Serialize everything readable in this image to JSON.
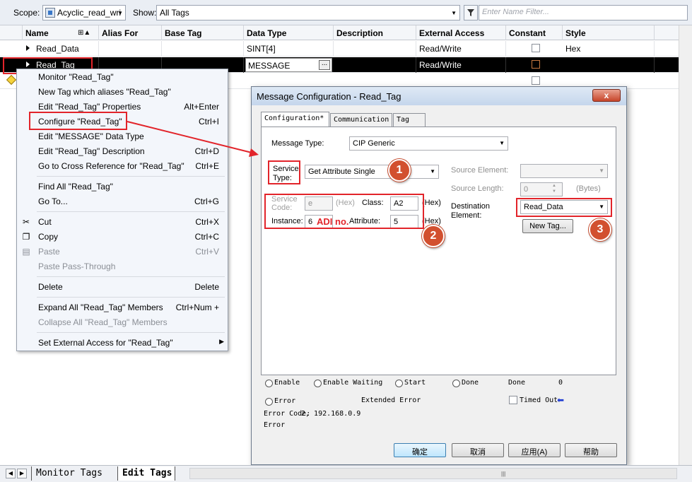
{
  "toolbar": {
    "scope_label": "Scope:",
    "scope_value": "Acyclic_read_wri",
    "show_label": "Show:",
    "show_value": "All Tags",
    "filter_placeholder": "Enter Name Filter..."
  },
  "grid": {
    "columns": [
      "Name",
      "Alias For",
      "Base Tag",
      "Data Type",
      "Description",
      "External Access",
      "Constant",
      "Style"
    ],
    "rows": [
      {
        "name": "Read_Data",
        "alias_for": "",
        "base_tag": "",
        "data_type": "SINT[4]",
        "description": "",
        "external_access": "Read/Write",
        "style": "Hex"
      },
      {
        "name": "Read_Tag",
        "alias_for": "",
        "base_tag": "",
        "data_type": "MESSAGE",
        "description": "",
        "external_access": "Read/Write",
        "style": ""
      }
    ],
    "ellipsis": "..."
  },
  "context_menu": {
    "items": [
      {
        "label": "Monitor \"Read_Tag\"",
        "shortcut": "",
        "disabled": false
      },
      {
        "label": "New Tag which aliases \"Read_Tag\"",
        "shortcut": "",
        "disabled": false
      },
      {
        "label": "Edit \"Read_Tag\" Properties",
        "shortcut": "Alt+Enter",
        "disabled": false
      },
      {
        "label": "Configure \"Read_Tag\"",
        "shortcut": "Ctrl+I",
        "disabled": false
      },
      {
        "label": "Edit \"MESSAGE\" Data Type",
        "shortcut": "",
        "disabled": false
      },
      {
        "label": "Edit \"Read_Tag\" Description",
        "shortcut": "Ctrl+D",
        "disabled": false
      },
      {
        "label": "Go to Cross Reference for \"Read_Tag\"",
        "shortcut": "Ctrl+E",
        "disabled": false
      },
      {
        "label": "Find All \"Read_Tag\"",
        "shortcut": "",
        "disabled": false
      },
      {
        "label": "Go To...",
        "shortcut": "Ctrl+G",
        "disabled": false
      },
      {
        "label": "Cut",
        "shortcut": "Ctrl+X",
        "disabled": false
      },
      {
        "label": "Copy",
        "shortcut": "Ctrl+C",
        "disabled": false
      },
      {
        "label": "Paste",
        "shortcut": "Ctrl+V",
        "disabled": true
      },
      {
        "label": "Paste Pass-Through",
        "shortcut": "",
        "disabled": true
      },
      {
        "label": "Delete",
        "shortcut": "Delete",
        "disabled": false
      },
      {
        "label": "Expand All \"Read_Tag\" Members",
        "shortcut": "Ctrl+Num +",
        "disabled": false
      },
      {
        "label": "Collapse All \"Read_Tag\" Members",
        "shortcut": "",
        "disabled": true
      },
      {
        "label": "Set External Access for \"Read_Tag\"",
        "shortcut": "",
        "disabled": false
      }
    ]
  },
  "dialog": {
    "title": "Message Configuration - Read_Tag",
    "close": "x",
    "tabs": [
      "Configuration*",
      "Communication",
      "Tag"
    ],
    "message_type_label": "Message Type:",
    "message_type_value": "CIP Generic",
    "service_type_label_1": "Service",
    "service_type_label_2": "Type:",
    "service_type_value": "Get Attribute Single",
    "service_code_label_1": "Service",
    "service_code_label_2": "Code:",
    "service_code_value": "e",
    "hex": "(Hex)",
    "class_label": "Class:",
    "class_value": "A2",
    "instance_label": "Instance:",
    "instance_value": "6",
    "adi_note": "ADI no.",
    "attribute_label": "Attribute:",
    "attribute_value": "5",
    "source_element_label": "Source Element:",
    "source_length_label": "Source Length:",
    "source_length_value": "0",
    "bytes": "(Bytes)",
    "destination_label_1": "Destination",
    "destination_label_2": "Element:",
    "destination_value": "Read_Data",
    "new_tag": "New Tag...",
    "status": {
      "enable": "Enable",
      "enable_waiting": "Enable Waiting",
      "start": "Start",
      "done": "Done",
      "done_length_label": "Done",
      "done_length_value": "0",
      "error": "Error",
      "extended_error": "Extended Error",
      "timed_out": "Timed Out",
      "error_code_label": "Error Code:",
      "error_code_value": "2, 192.168.0.9",
      "error_path_label": "Error"
    },
    "buttons": {
      "ok": "确定",
      "cancel": "取消",
      "apply": "应用(A)",
      "help": "帮助"
    }
  },
  "badges": [
    "1",
    "2",
    "3"
  ],
  "bottom_tabs": [
    "Monitor Tags",
    "Edit Tags"
  ],
  "colors": {
    "annotation_red": "#e2242a",
    "badge": "#d2502f",
    "selected_row": "#000000"
  }
}
